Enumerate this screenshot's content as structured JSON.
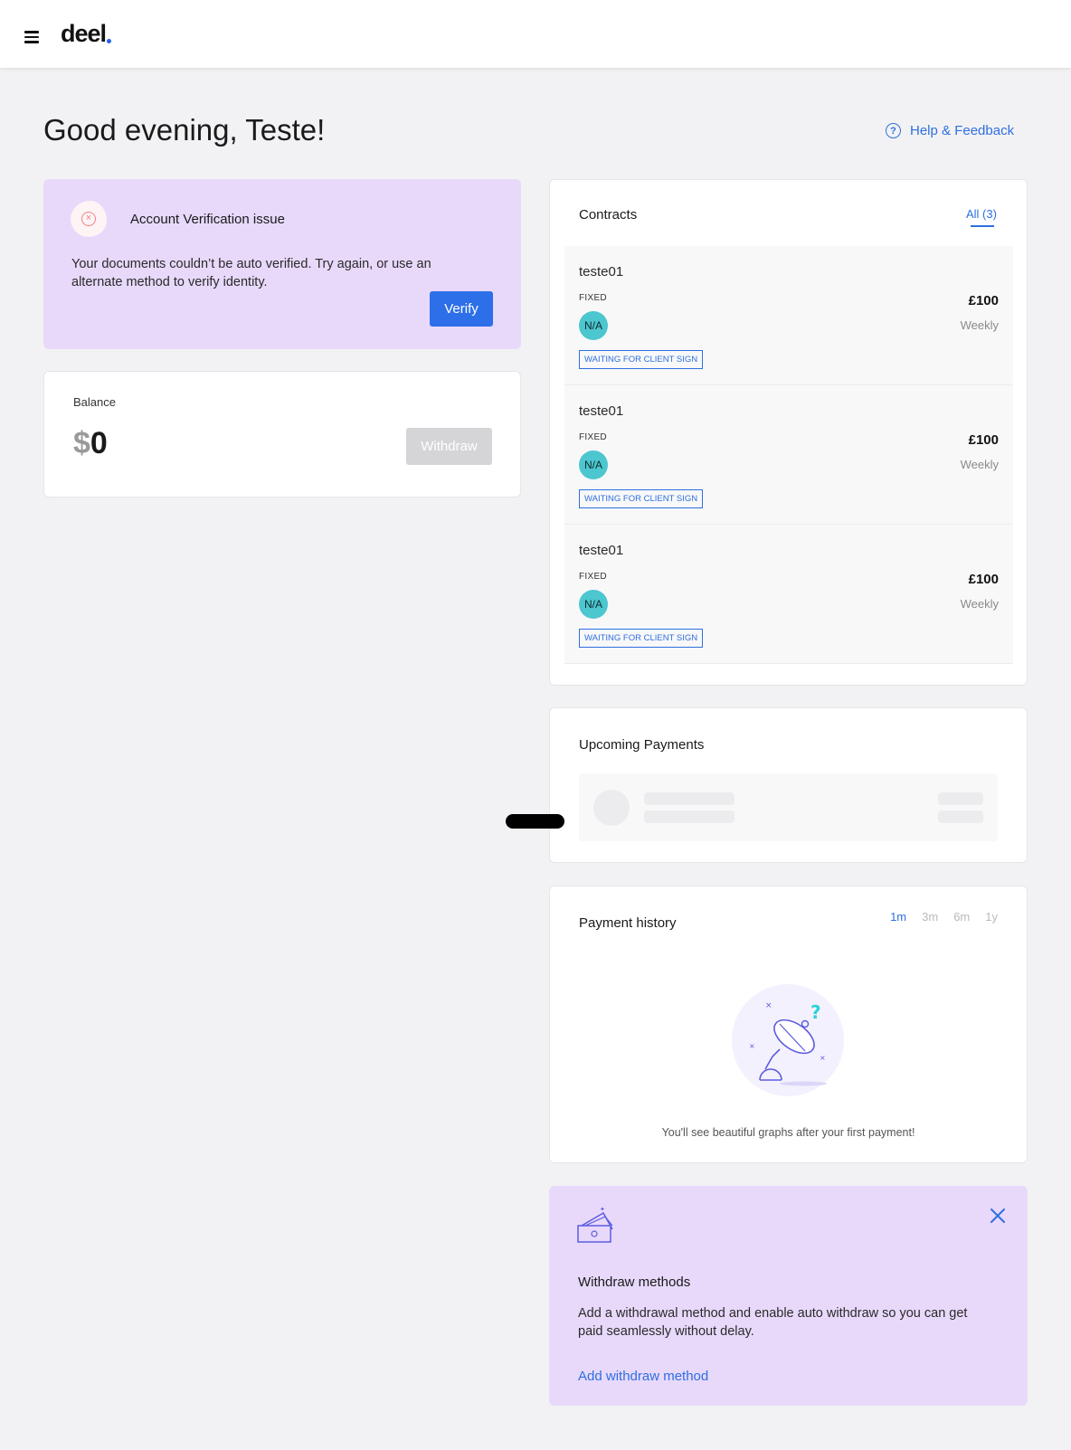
{
  "header": {
    "logo": "deel"
  },
  "greeting": "Good evening, Teste!",
  "help": {
    "label": "Help & Feedback"
  },
  "verification": {
    "title": "Account Verification issue",
    "text": "Your documents couldn’t be auto verified. Try again, or use an alternate method to verify identity.",
    "button": "Verify"
  },
  "balance": {
    "label": "Balance",
    "currency": "$",
    "amount": "0",
    "button": "Withdraw"
  },
  "contracts": {
    "title": "Contracts",
    "filter": "All (3)",
    "items": [
      {
        "name": "teste01",
        "type": "FIXED",
        "avatar": "N/A",
        "status": "WAITING FOR CLIENT SIGN",
        "amount": "£100",
        "frequency": "Weekly"
      },
      {
        "name": "teste01",
        "type": "FIXED",
        "avatar": "N/A",
        "status": "WAITING FOR CLIENT SIGN",
        "amount": "£100",
        "frequency": "Weekly"
      },
      {
        "name": "teste01",
        "type": "FIXED",
        "avatar": "N/A",
        "status": "WAITING FOR CLIENT SIGN",
        "amount": "£100",
        "frequency": "Weekly"
      }
    ]
  },
  "upcoming": {
    "title": "Upcoming Payments"
  },
  "history": {
    "title": "Payment history",
    "ranges": [
      "1m",
      "3m",
      "6m",
      "1y"
    ],
    "active_range": "1m",
    "empty_text": "You'll see beautiful graphs after your first payment!"
  },
  "withdraw_methods": {
    "title": "Withdraw methods",
    "text": "Add a withdrawal method and enable auto withdraw so you can get paid seamlessly without delay.",
    "link": "Add withdraw method"
  },
  "colors": {
    "accent": "#2f6fe0",
    "purple_bg": "#e8d9fb",
    "avatar": "#4cc6cf"
  },
  "icons": [
    "menu-icon",
    "help-icon",
    "error-icon",
    "close-icon",
    "satellite-dish-icon",
    "money-stack-icon"
  ]
}
